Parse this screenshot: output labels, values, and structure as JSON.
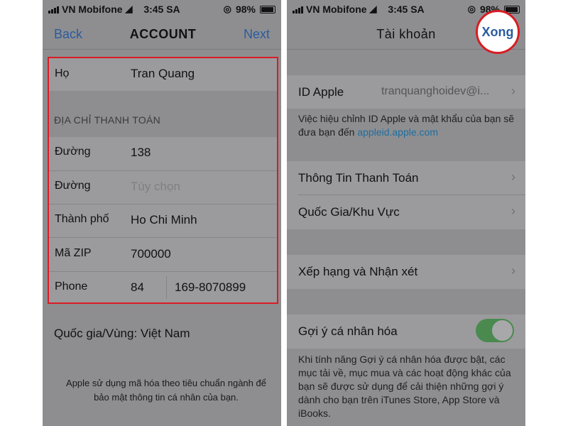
{
  "left": {
    "status": {
      "carrier": "VN Mobifone",
      "time": "3:45 SA",
      "battery": "98%"
    },
    "nav": {
      "back": "Back",
      "title": "ACCOUNT",
      "next": "Next"
    },
    "last_name": {
      "label": "Họ",
      "value": "Tran Quang"
    },
    "billing_header": "ĐỊA CHỈ THANH TOÁN",
    "fields": [
      {
        "label": "Đường",
        "value": "138",
        "placeholder": ""
      },
      {
        "label": "Đường",
        "value": "",
        "placeholder": "Tùy chọn"
      },
      {
        "label": "Thành phố",
        "value": "Ho Chi Minh",
        "placeholder": ""
      },
      {
        "label": "Mã ZIP",
        "value": "700000",
        "placeholder": ""
      }
    ],
    "phone": {
      "label": "Phone",
      "code": "84",
      "number": "169-8070899"
    },
    "country": "Quốc gia/Vùng: Việt Nam",
    "footer": "Apple sử dụng mã hóa theo tiêu chuẩn ngành để bảo mật thông tin cá nhân của bạn."
  },
  "right": {
    "status": {
      "carrier": "VN Mobifone",
      "time": "3:45 SA",
      "battery": "98%"
    },
    "nav": {
      "title": "Tài khoản",
      "done": "Xong"
    },
    "apple_id": {
      "label": "ID Apple",
      "value": "tranquanghoidev@i..."
    },
    "apple_id_note": "Việc hiệu chỉnh ID Apple và mật khẩu của bạn sẽ đưa bạn đến",
    "apple_id_link": "appleid.apple.com",
    "payment_info": "Thông Tin Thanh Toán",
    "country_region": "Quốc Gia/Khu Vực",
    "ratings": "Xếp hạng và Nhận xét",
    "personalized": {
      "label": "Gợi ý cá nhân hóa",
      "on": true
    },
    "personalized_note": "Khi tính năng Gợi ý cá nhân hóa được bật, các mục tải về, mục mua và các hoạt động khác của bạn sẽ được sử dụng để cải thiện những gợi ý dành cho bạn trên iTunes Store, App Store và iBooks."
  },
  "colors": {
    "accent": "#2a5c9e",
    "highlight": "#d91c24",
    "toggle_on": "#4a8a4f",
    "link": "#1d6e9e"
  }
}
